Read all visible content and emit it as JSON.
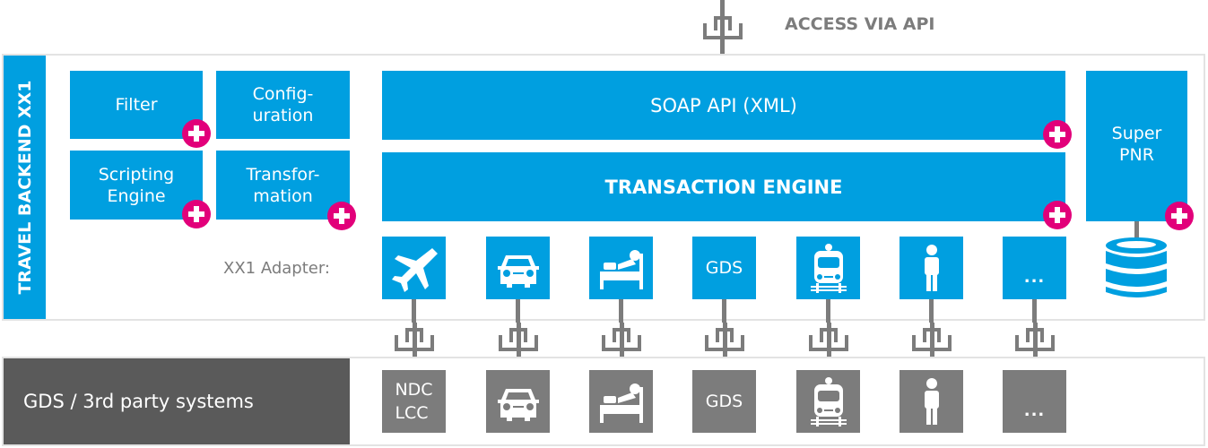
{
  "top": {
    "access_label": "ACCESS VIA API"
  },
  "backend": {
    "side_label": "TRAVEL BACKEND XX1",
    "modules": [
      {
        "label": "Filter",
        "icon": "plus-icon"
      },
      {
        "label": "Config-\nuration",
        "icon": null
      },
      {
        "label": "Scripting\nEngine",
        "icon": "plus-icon"
      },
      {
        "label": "Transfor-\nmation",
        "icon": "plus-icon"
      }
    ],
    "soap_api": "SOAP API (XML)",
    "transaction_engine": "TRANSACTION ENGINE",
    "super_pnr": "Super\nPNR",
    "adapter_label": "XX1 Adapter:",
    "adapters": [
      {
        "type": "airplane-icon",
        "text": ""
      },
      {
        "type": "car-icon",
        "text": ""
      },
      {
        "type": "bed-icon",
        "text": ""
      },
      {
        "type": "text",
        "text": "GDS"
      },
      {
        "type": "train-icon",
        "text": ""
      },
      {
        "type": "person-icon",
        "text": ""
      },
      {
        "type": "text",
        "text": "..."
      }
    ]
  },
  "third_party": {
    "label": "GDS / 3rd party systems",
    "systems": [
      {
        "type": "text",
        "text": "NDC\nLCC"
      },
      {
        "type": "car-icon",
        "text": ""
      },
      {
        "type": "bed-icon",
        "text": ""
      },
      {
        "type": "text",
        "text": "GDS"
      },
      {
        "type": "train-icon",
        "text": ""
      },
      {
        "type": "person-icon",
        "text": ""
      },
      {
        "type": "text",
        "text": "..."
      }
    ]
  },
  "colors": {
    "blue": "#009fe0",
    "grey": "#7c7c7c",
    "dark_grey": "#5a5a5a",
    "magenta": "#e2007a",
    "frame": "#e3e3e3"
  }
}
